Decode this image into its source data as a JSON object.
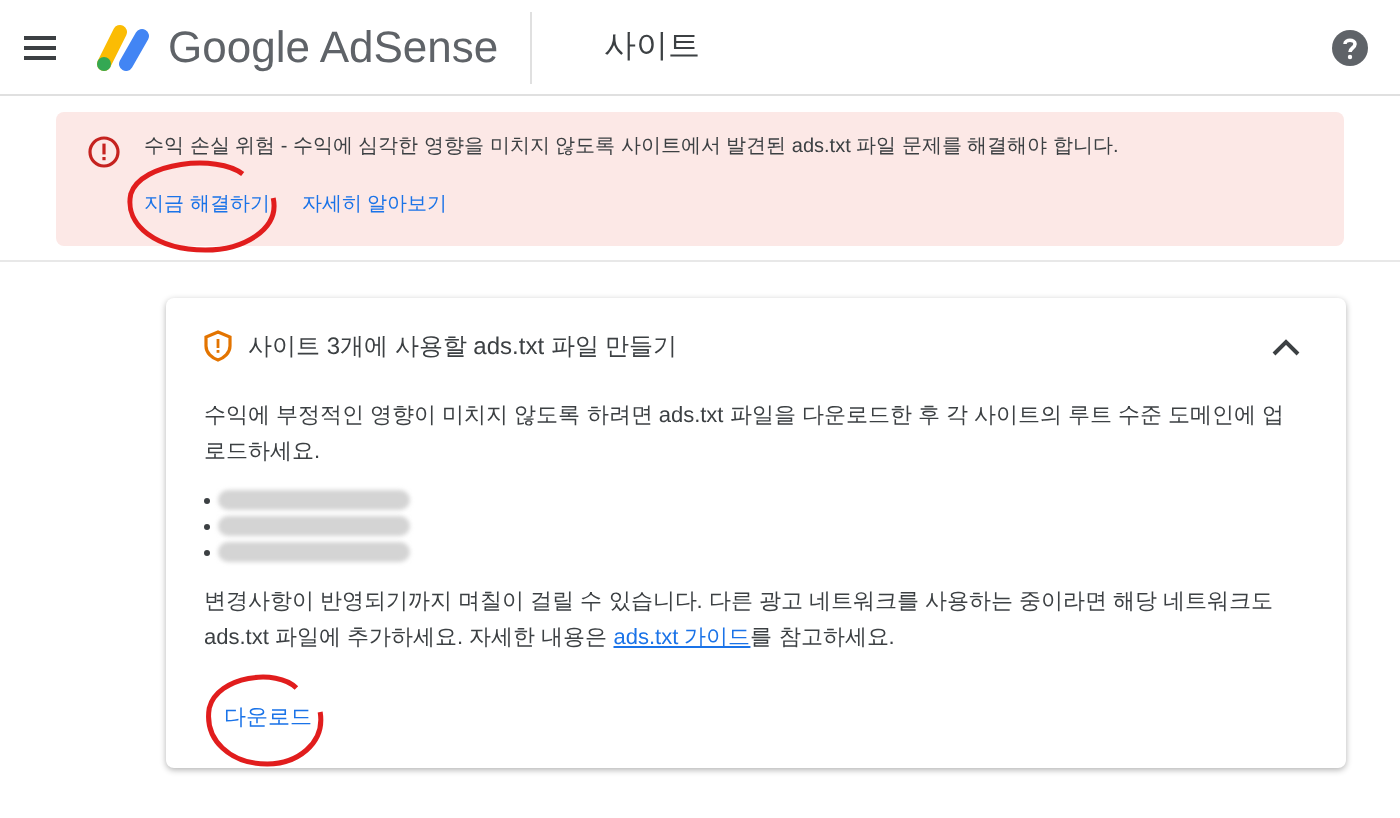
{
  "header": {
    "product": "Google AdSense",
    "page_title": "사이트"
  },
  "alert": {
    "message": "수익 손실 위험 - 수익에 심각한 영향을 미치지 않도록 사이트에서 발견된 ads.txt 파일 문제를 해결해야 합니다.",
    "actions": [
      {
        "label": "지금 해결하기",
        "circled": true
      },
      {
        "label": "자세히 알아보기",
        "circled": false
      }
    ]
  },
  "card": {
    "title": "사이트 3개에 사용할 ads.txt 파일 만들기",
    "expanded": true,
    "intro": "수익에 부정적인 영향이 미치지 않도록 하려면 ads.txt 파일을 다운로드한 후 각 사이트의 루트 수준 도메인에 업로드하세요.",
    "sites": [
      {
        "kind": "redacted"
      },
      {
        "kind": "redacted"
      },
      {
        "kind": "redacted"
      }
    ],
    "note": {
      "before": "변경사항이 반영되기까지 며칠이 걸릴 수 있습니다. 다른 광고 네트워크를 사용하는 중이라면 해당 네트워크도 ads.txt 파일에 추가하세요. 자세한 내용은 ",
      "link": "ads.txt 가이드",
      "after": "를 참고하세요."
    },
    "download": {
      "label": "다운로드",
      "circled": true
    }
  }
}
